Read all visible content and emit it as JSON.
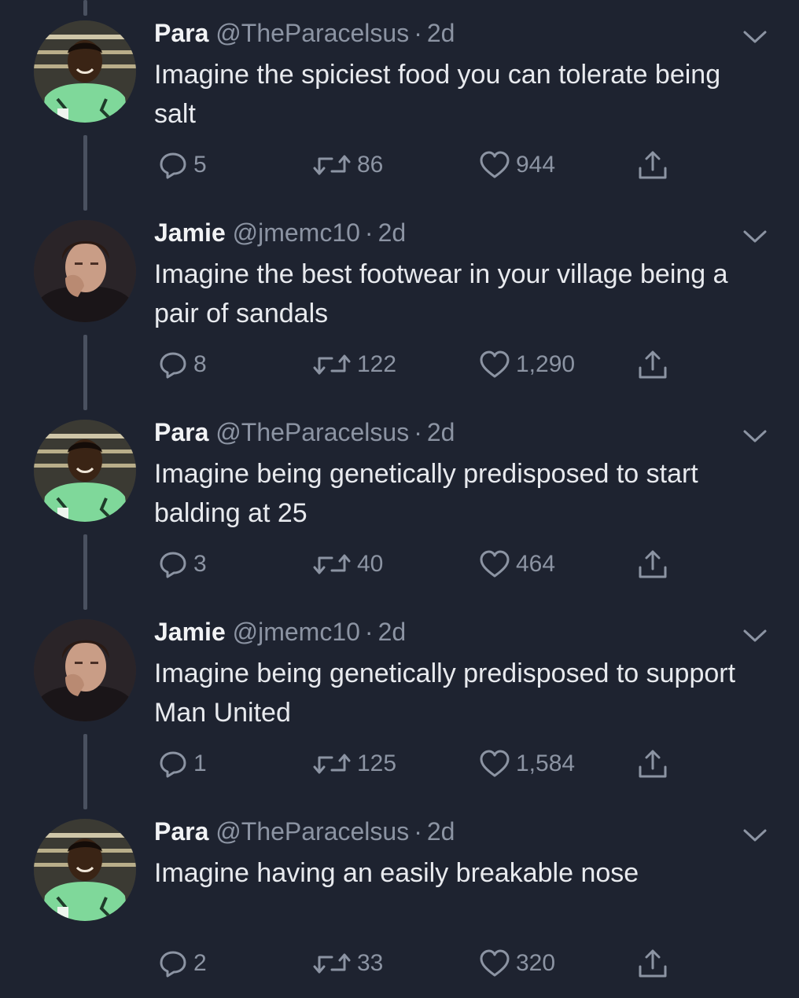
{
  "tweets": [
    {
      "name": "Para",
      "handle": "@TheParacelsus",
      "time": "2d",
      "text": "Imagine the spiciest food you can tolerate being salt",
      "replies": "5",
      "retweets": "86",
      "likes": "944",
      "avatar": "avatar-para"
    },
    {
      "name": "Jamie",
      "handle": "@jmemc10",
      "time": "2d",
      "text": "Imagine the best footwear in your village being a pair of sandals",
      "replies": "8",
      "retweets": "122",
      "likes": "1,290",
      "avatar": "avatar-jamie"
    },
    {
      "name": "Para",
      "handle": "@TheParacelsus",
      "time": "2d",
      "text": "Imagine being genetically predisposed to start balding at 25",
      "replies": "3",
      "retweets": "40",
      "likes": "464",
      "avatar": "avatar-para"
    },
    {
      "name": "Jamie",
      "handle": "@jmemc10",
      "time": "2d",
      "text": "Imagine being genetically predisposed to support Man United",
      "replies": "1",
      "retweets": "125",
      "likes": "1,584",
      "avatar": "avatar-jamie"
    },
    {
      "name": "Para",
      "handle": "@TheParacelsus",
      "time": "2d",
      "text": "Imagine having an easily breakable nose",
      "replies": "2",
      "retweets": "33",
      "likes": "320",
      "avatar": "avatar-para"
    }
  ],
  "icons": {
    "reply": "reply-icon",
    "retweet": "retweet-icon",
    "like": "heart-icon",
    "share": "share-icon",
    "menu": "chevron-down-icon"
  },
  "colors": {
    "background": "#1e2330",
    "text": "#e8eaee",
    "secondary": "#8c94a3",
    "thread_line": "#4a5160",
    "jersey_green": "#7fd89a"
  }
}
